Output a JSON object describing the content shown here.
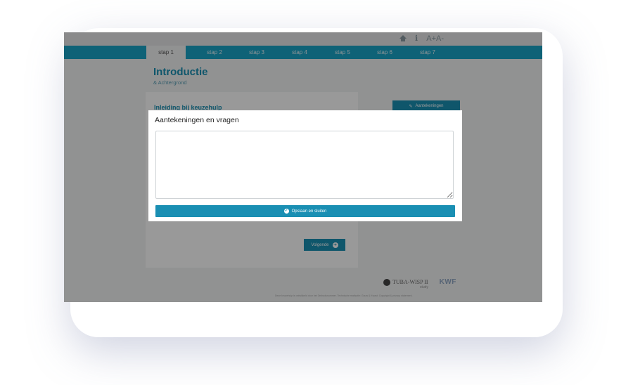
{
  "topbar": {
    "info_icon": "ℹ",
    "font_sizes": "A+A-"
  },
  "nav": {
    "tabs": [
      {
        "label": "stap 1",
        "active": true
      },
      {
        "label": "stap 2"
      },
      {
        "label": "stap 3"
      },
      {
        "label": "stap 4"
      },
      {
        "label": "stap 5"
      },
      {
        "label": "stap 6"
      },
      {
        "label": "stap 7"
      }
    ]
  },
  "page": {
    "title": "Introductie",
    "subtitle": "& Achtergrond",
    "card_title": "Inleiding bij keuzehulp",
    "notes_button": "Aantekeningen",
    "next_button": "Volgende"
  },
  "footer": {
    "logo_tuba": "TUBA-WISP II",
    "logo_tuba_sub": "study",
    "logo_kwf": "KWF",
    "text": "Deze keuzehulp is ontwikkeld door het Ombudsnummer. Technische realisatie: Gouw & Kwast. Copyright & privacy statement."
  },
  "modal": {
    "title": "Aantekeningen en vragen",
    "textarea_value": "",
    "save_button": "Opslaan en sluiten"
  },
  "colors": {
    "accent": "#1a8fb3",
    "nav": "#1aa3c6",
    "overlay": "rgba(0,0,0,0.4)"
  }
}
